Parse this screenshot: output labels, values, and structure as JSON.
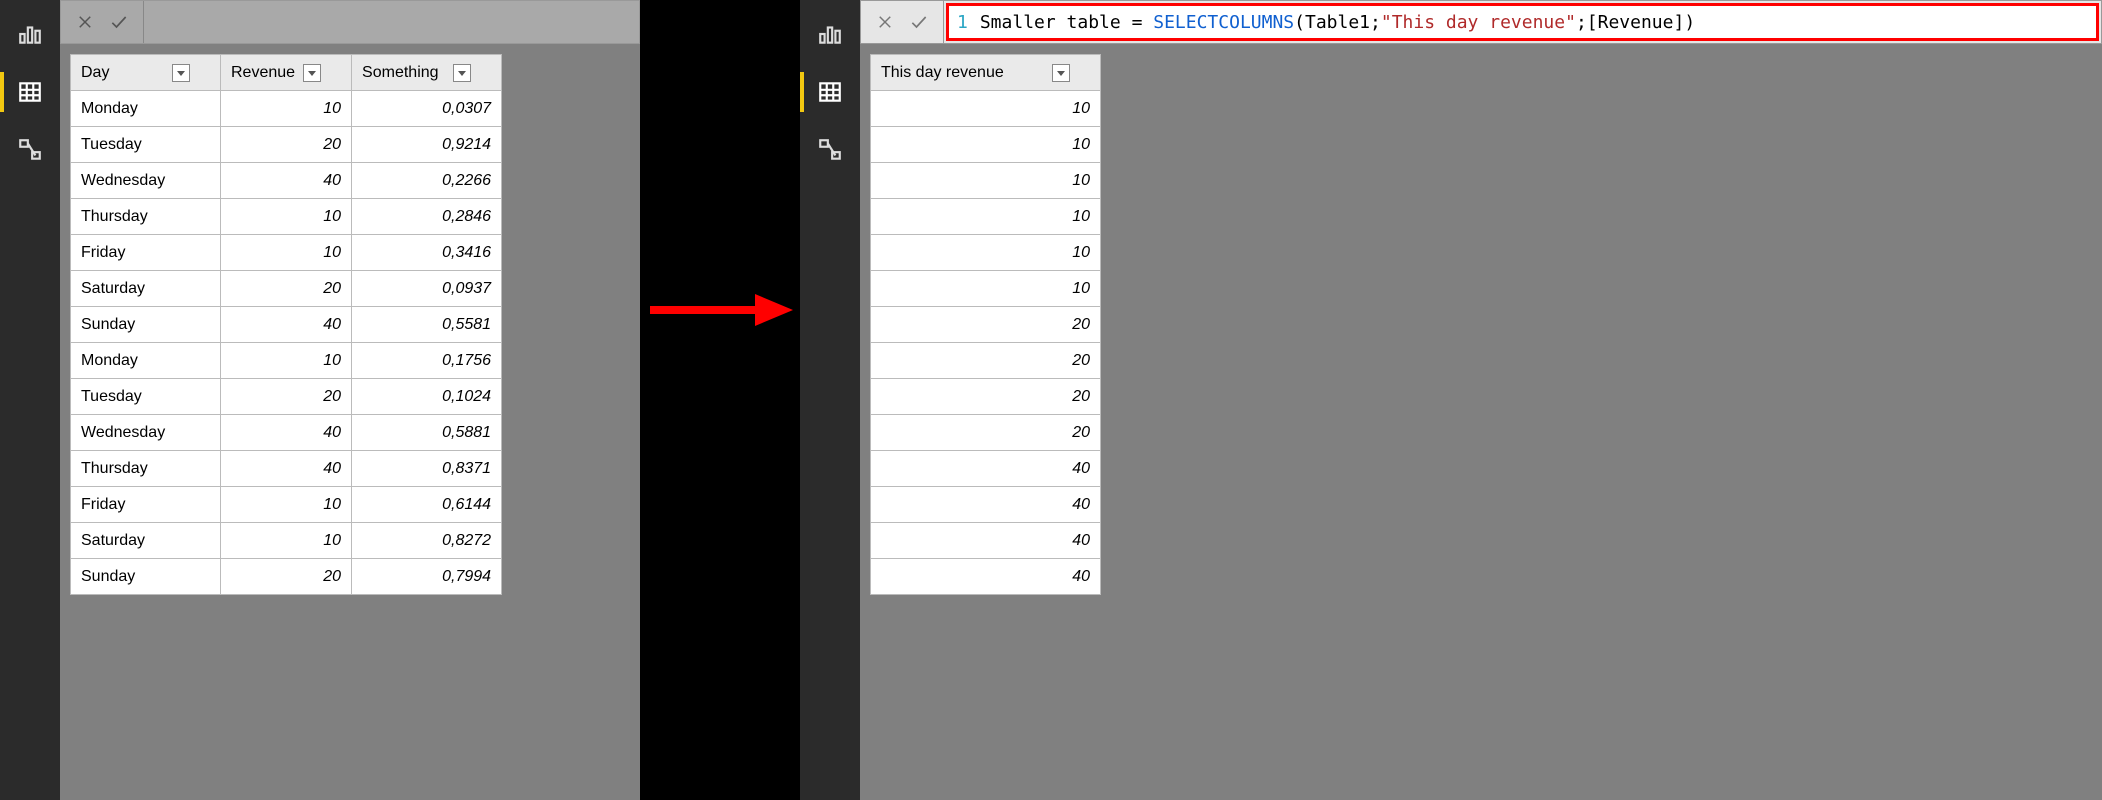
{
  "left": {
    "columns": [
      "Day",
      "Revenue",
      "Something"
    ],
    "rows": [
      {
        "day": "Monday",
        "revenue": "10",
        "something": "0,0307"
      },
      {
        "day": "Tuesday",
        "revenue": "20",
        "something": "0,9214"
      },
      {
        "day": "Wednesday",
        "revenue": "40",
        "something": "0,2266"
      },
      {
        "day": "Thursday",
        "revenue": "10",
        "something": "0,2846"
      },
      {
        "day": "Friday",
        "revenue": "10",
        "something": "0,3416"
      },
      {
        "day": "Saturday",
        "revenue": "20",
        "something": "0,0937"
      },
      {
        "day": "Sunday",
        "revenue": "40",
        "something": "0,5581"
      },
      {
        "day": "Monday",
        "revenue": "10",
        "something": "0,1756"
      },
      {
        "day": "Tuesday",
        "revenue": "20",
        "something": "0,1024"
      },
      {
        "day": "Wednesday",
        "revenue": "40",
        "something": "0,5881"
      },
      {
        "day": "Thursday",
        "revenue": "40",
        "something": "0,8371"
      },
      {
        "day": "Friday",
        "revenue": "10",
        "something": "0,6144"
      },
      {
        "day": "Saturday",
        "revenue": "10",
        "something": "0,8272"
      },
      {
        "day": "Sunday",
        "revenue": "20",
        "something": "0,7994"
      }
    ]
  },
  "right": {
    "formula": {
      "line_no": "1",
      "name": "Smaller table",
      "eq": " = ",
      "fn": "SELECTCOLUMNS",
      "open": "(",
      "arg1": "Table1",
      "sep1": ";",
      "str": "\"This day revenue\"",
      "sep2": ";",
      "arg3": "[Revenue]",
      "close": ")"
    },
    "column": "This day revenue",
    "values": [
      "10",
      "10",
      "10",
      "10",
      "10",
      "10",
      "20",
      "20",
      "20",
      "20",
      "40",
      "40",
      "40",
      "40"
    ]
  }
}
